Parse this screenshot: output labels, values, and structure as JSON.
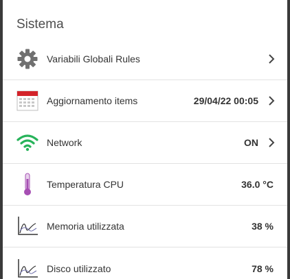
{
  "section": {
    "title": "Sistema"
  },
  "rows": [
    {
      "label": "Variabili Globali Rules",
      "value": "",
      "icon": "gear-icon"
    },
    {
      "label": "Aggiornamento items",
      "value": "29/04/22 00:05",
      "icon": "calendar-icon"
    },
    {
      "label": "Network",
      "value": "ON",
      "icon": "wifi-icon"
    },
    {
      "label": "Temperatura CPU",
      "value": "36.0 °C",
      "icon": "thermometer-icon"
    },
    {
      "label": "Memoria utilizzata",
      "value": "38 %",
      "icon": "line-chart-icon"
    },
    {
      "label": "Disco utilizzato",
      "value": "78 %",
      "icon": "line-chart-icon"
    }
  ],
  "colors": {
    "wifi": "#27b35a",
    "calendar": "#d3232a",
    "thermometer": "#a64fb3",
    "gear": "#6b6b6b"
  }
}
